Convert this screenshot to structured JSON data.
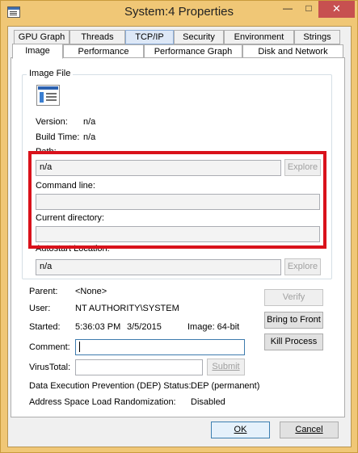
{
  "window": {
    "title": "System:4 Properties",
    "minimize": "—",
    "maximize": "□",
    "close": "✕"
  },
  "tabs_back": [
    "GPU Graph",
    "Threads",
    "TCP/IP",
    "Security",
    "Environment",
    "Strings"
  ],
  "tabs_front": [
    "Image",
    "Performance",
    "Performance Graph",
    "Disk and Network"
  ],
  "active_tab": "Image",
  "image_file": {
    "group_title": "Image File",
    "version_label": "Version:",
    "version_value": "n/a",
    "build_time_label": "Build Time:",
    "build_time_value": "n/a",
    "path_label": "Path:",
    "path_value": "n/a",
    "explore_label": "Explore",
    "command_line_label": "Command line:",
    "command_line_value": "",
    "current_directory_label": "Current directory:",
    "current_directory_value": "",
    "autostart_label": "Autostart Location:",
    "autostart_value": "n/a",
    "autostart_explore_label": "Explore"
  },
  "process": {
    "parent_label": "Parent:",
    "parent_value": "<None>",
    "user_label": "User:",
    "user_value": "NT AUTHORITY\\SYSTEM",
    "started_label": "Started:",
    "started_time": "5:36:03 PM",
    "started_date": "3/5/2015",
    "image_label": "Image: 64-bit",
    "comment_label": "Comment:",
    "comment_value": "",
    "virustotal_label": "VirusTotal:",
    "virustotal_value": "",
    "submit_label": "Submit",
    "dep_label": "Data Execution Prevention (DEP) Status:",
    "dep_value": "DEP (permanent)",
    "aslr_label": "Address Space Load Randomization:",
    "aslr_value": "Disabled"
  },
  "buttons": {
    "verify": "Verify",
    "bring_to_front": "Bring to Front",
    "kill_process": "Kill Process",
    "ok": "OK",
    "cancel": "Cancel"
  },
  "colors": {
    "highlight": "#d9121b",
    "frame": "#f0c776",
    "close_button": "#c75050"
  }
}
